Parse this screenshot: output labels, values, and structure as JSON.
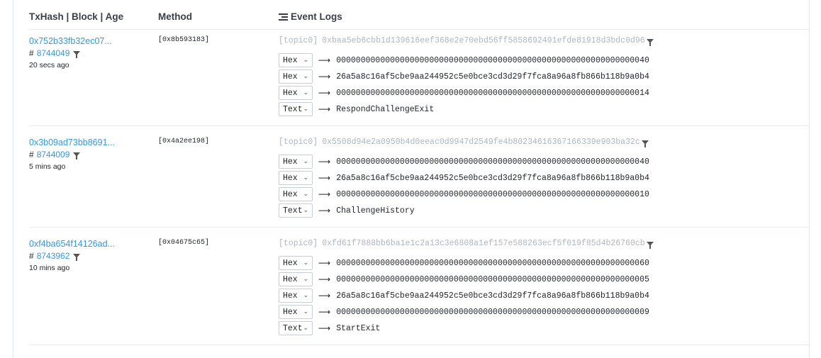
{
  "header": {
    "col_tx": "TxHash | Block | Age",
    "col_method": "Method",
    "col_logs": "Event Logs"
  },
  "rows": [
    {
      "tx": "0x752b33fb32ec07...",
      "block_prefix": "#",
      "block": "8744049",
      "age": "20 secs ago",
      "method": "[0x8b593183]",
      "topic_label": "[topic0]",
      "topic": "0xbaa5eb6cbb1d139616eef368e2e70ebd56ff5858692491efde81918d3bdc0d96",
      "data": [
        {
          "format": "Hex",
          "value": "0000000000000000000000000000000000000000000000000000000000000040"
        },
        {
          "format": "Hex",
          "value": "26a5a8c16af5cbe9aa244952c5e0bce3cd3d29f7fca8a96a8fb866b118b9a0b4"
        },
        {
          "format": "Hex",
          "value": "0000000000000000000000000000000000000000000000000000000000000014"
        },
        {
          "format": "Text",
          "value": "RespondChallengeExit"
        }
      ]
    },
    {
      "tx": "0x3b09ad73bb8691...",
      "block_prefix": "#",
      "block": "8744009",
      "age": "5 mins ago",
      "method": "[0x4a2ee198]",
      "topic_label": "[topic0]",
      "topic": "0x5508d94e2a0950b4d0eeac0d9947d2549fe4b80234616367166339e903ba32c",
      "data": [
        {
          "format": "Hex",
          "value": "0000000000000000000000000000000000000000000000000000000000000040"
        },
        {
          "format": "Hex",
          "value": "26a5a8c16af5cbe9aa244952c5e0bce3cd3d29f7fca8a96a8fb866b118b9a0b4"
        },
        {
          "format": "Hex",
          "value": "0000000000000000000000000000000000000000000000000000000000000010"
        },
        {
          "format": "Text",
          "value": "ChallengeHistory"
        }
      ]
    },
    {
      "tx": "0xf4ba654f14126ad...",
      "block_prefix": "#",
      "block": "8743962",
      "age": "10 mins ago",
      "method": "[0x04675c65]",
      "topic_label": "[topic0]",
      "topic": "0xfd61f7888bb6ba1e1c2a13c3e6808a1ef157e588263ecf5f019f85d4b26760cb",
      "data": [
        {
          "format": "Hex",
          "value": "0000000000000000000000000000000000000000000000000000000000000060"
        },
        {
          "format": "Hex",
          "value": "0000000000000000000000000000000000000000000000000000000000000005"
        },
        {
          "format": "Hex",
          "value": "26a5a8c16af5cbe9aa244952c5e0bce3cd3d29f7fca8a96a8fb866b118b9a0b4"
        },
        {
          "format": "Hex",
          "value": "0000000000000000000000000000000000000000000000000000000000000009"
        },
        {
          "format": "Text",
          "value": "StartExit"
        }
      ]
    }
  ],
  "icons": {
    "filter": "filter-icon",
    "list": "list-icon",
    "dropdown": "chevron-down-icon",
    "arrow": "right-arrow-icon"
  },
  "colors": {
    "link": "#3498db",
    "topic": "#b0b6bd",
    "border": "#e7eaf3"
  }
}
